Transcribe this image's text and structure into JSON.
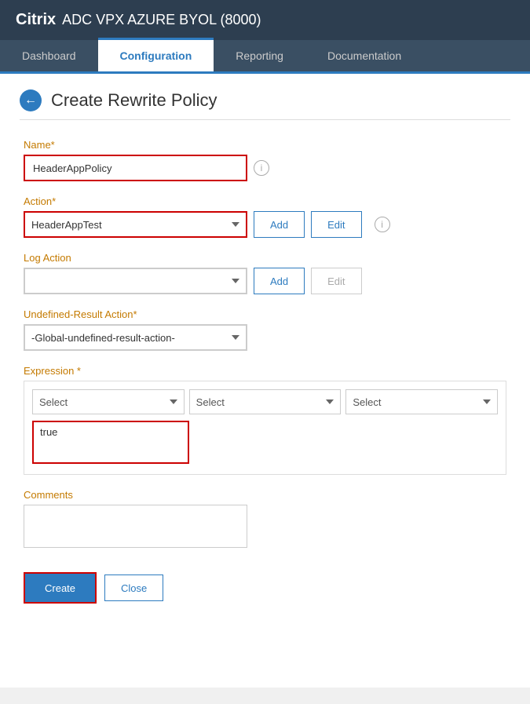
{
  "header": {
    "brand": "Citrix",
    "title": " ADC VPX AZURE BYOL (8000)"
  },
  "nav": {
    "tabs": [
      {
        "label": "Dashboard",
        "active": false
      },
      {
        "label": "Configuration",
        "active": true
      },
      {
        "label": "Reporting",
        "active": false
      },
      {
        "label": "Documentation",
        "active": false
      }
    ]
  },
  "page": {
    "back_icon": "←",
    "title": "Create Rewrite Policy"
  },
  "form": {
    "name_label": "Name*",
    "name_value": "HeaderAppPolicy",
    "name_info_icon": "i",
    "action_label": "Action*",
    "action_value": "HeaderAppTest",
    "action_add_btn": "Add",
    "action_edit_btn": "Edit",
    "action_info_icon": "i",
    "log_action_label": "Log Action",
    "log_action_placeholder": "",
    "log_action_add_btn": "Add",
    "log_action_edit_btn": "Edit",
    "undefined_label": "Undefined-Result Action*",
    "undefined_value": "-Global-undefined-result-action-",
    "expression_label": "Expression *",
    "expression_select1": "Select",
    "expression_select2": "Select",
    "expression_select3": "Select",
    "expression_textarea": "true",
    "comments_label": "Comments",
    "comments_value": "",
    "create_btn": "Create",
    "close_btn": "Close"
  }
}
